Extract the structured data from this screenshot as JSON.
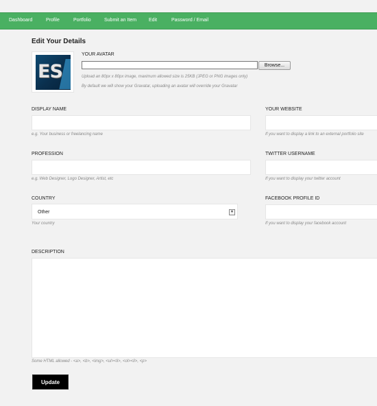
{
  "nav": {
    "items": [
      "Dashboard",
      "Profile",
      "Portfolio",
      "Submit an Item",
      "Edit",
      "Password / Email"
    ],
    "bar_color": "#4ab062"
  },
  "page": {
    "title": "Edit Your Details"
  },
  "avatar": {
    "label": "YOUR AVATAR",
    "initials": "ES",
    "browse_label": "Browse...",
    "hint1": "Upload an 80px x 80px image, maximum allowed size is 25KB (JPEG or PNG images only)",
    "hint2": "By default we will show your Gravatar, uploading an avatar will override your Gravatar"
  },
  "fields": {
    "display_name": {
      "label": "DISPLAY NAME",
      "hint": "e.g. Your business or freelancing name",
      "value": ""
    },
    "website": {
      "label": "YOUR WEBSITE",
      "hint": "If you want to display a link to an external portfolio site",
      "value": ""
    },
    "profession": {
      "label": "PROFESSION",
      "hint": "e.g. Web Designer, Logo Designer, Artist, etc",
      "value": ""
    },
    "twitter": {
      "label": "TWITTER USERNAME",
      "hint": "If you want to display your twitter account",
      "value": ""
    },
    "country": {
      "label": "COUNTRY",
      "value": "Other",
      "hint": "Your country"
    },
    "facebook": {
      "label": "FACEBOOK PROFILE ID",
      "hint": "If you want to display your facebook account",
      "value": ""
    },
    "description": {
      "label": "DESCRIPTION",
      "hint": "Some HTML allowed - <a>, <b>, <img>, <ul><li>, <ol><li>, <p>",
      "value": ""
    }
  },
  "actions": {
    "update_label": "Update"
  }
}
